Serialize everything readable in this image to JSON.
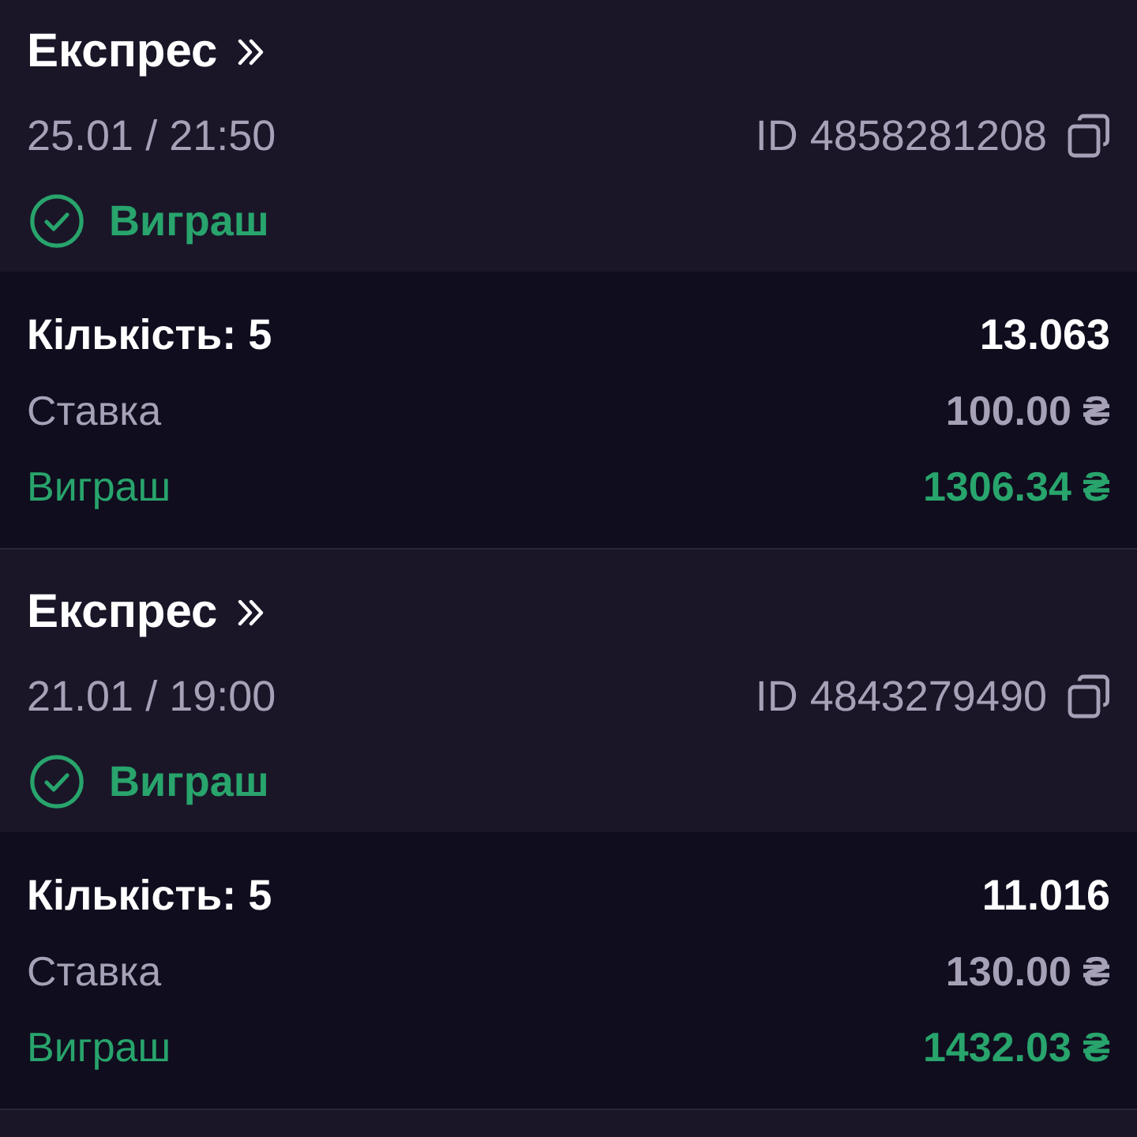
{
  "bets": [
    {
      "title": "Експрес",
      "datetime": "25.01 / 21:50",
      "id": "ID 4858281208",
      "status": {
        "kind": "won",
        "label": "Виграш"
      },
      "count": "Кількість: 5",
      "odds": "13.063",
      "rows": [
        {
          "kind": "stake",
          "label": "Ставка",
          "value": "100.00 ₴"
        },
        {
          "kind": "win",
          "label": "Виграш",
          "value": "1306.34 ₴"
        }
      ]
    },
    {
      "title": "Експрес",
      "datetime": "21.01 / 19:00",
      "id": "ID 4843279490",
      "status": {
        "kind": "won",
        "label": "Виграш"
      },
      "count": "Кількість: 5",
      "odds": "11.016",
      "rows": [
        {
          "kind": "stake",
          "label": "Ставка",
          "value": "130.00 ₴"
        },
        {
          "kind": "win",
          "label": "Виграш",
          "value": "1432.03 ₴"
        }
      ]
    }
  ]
}
